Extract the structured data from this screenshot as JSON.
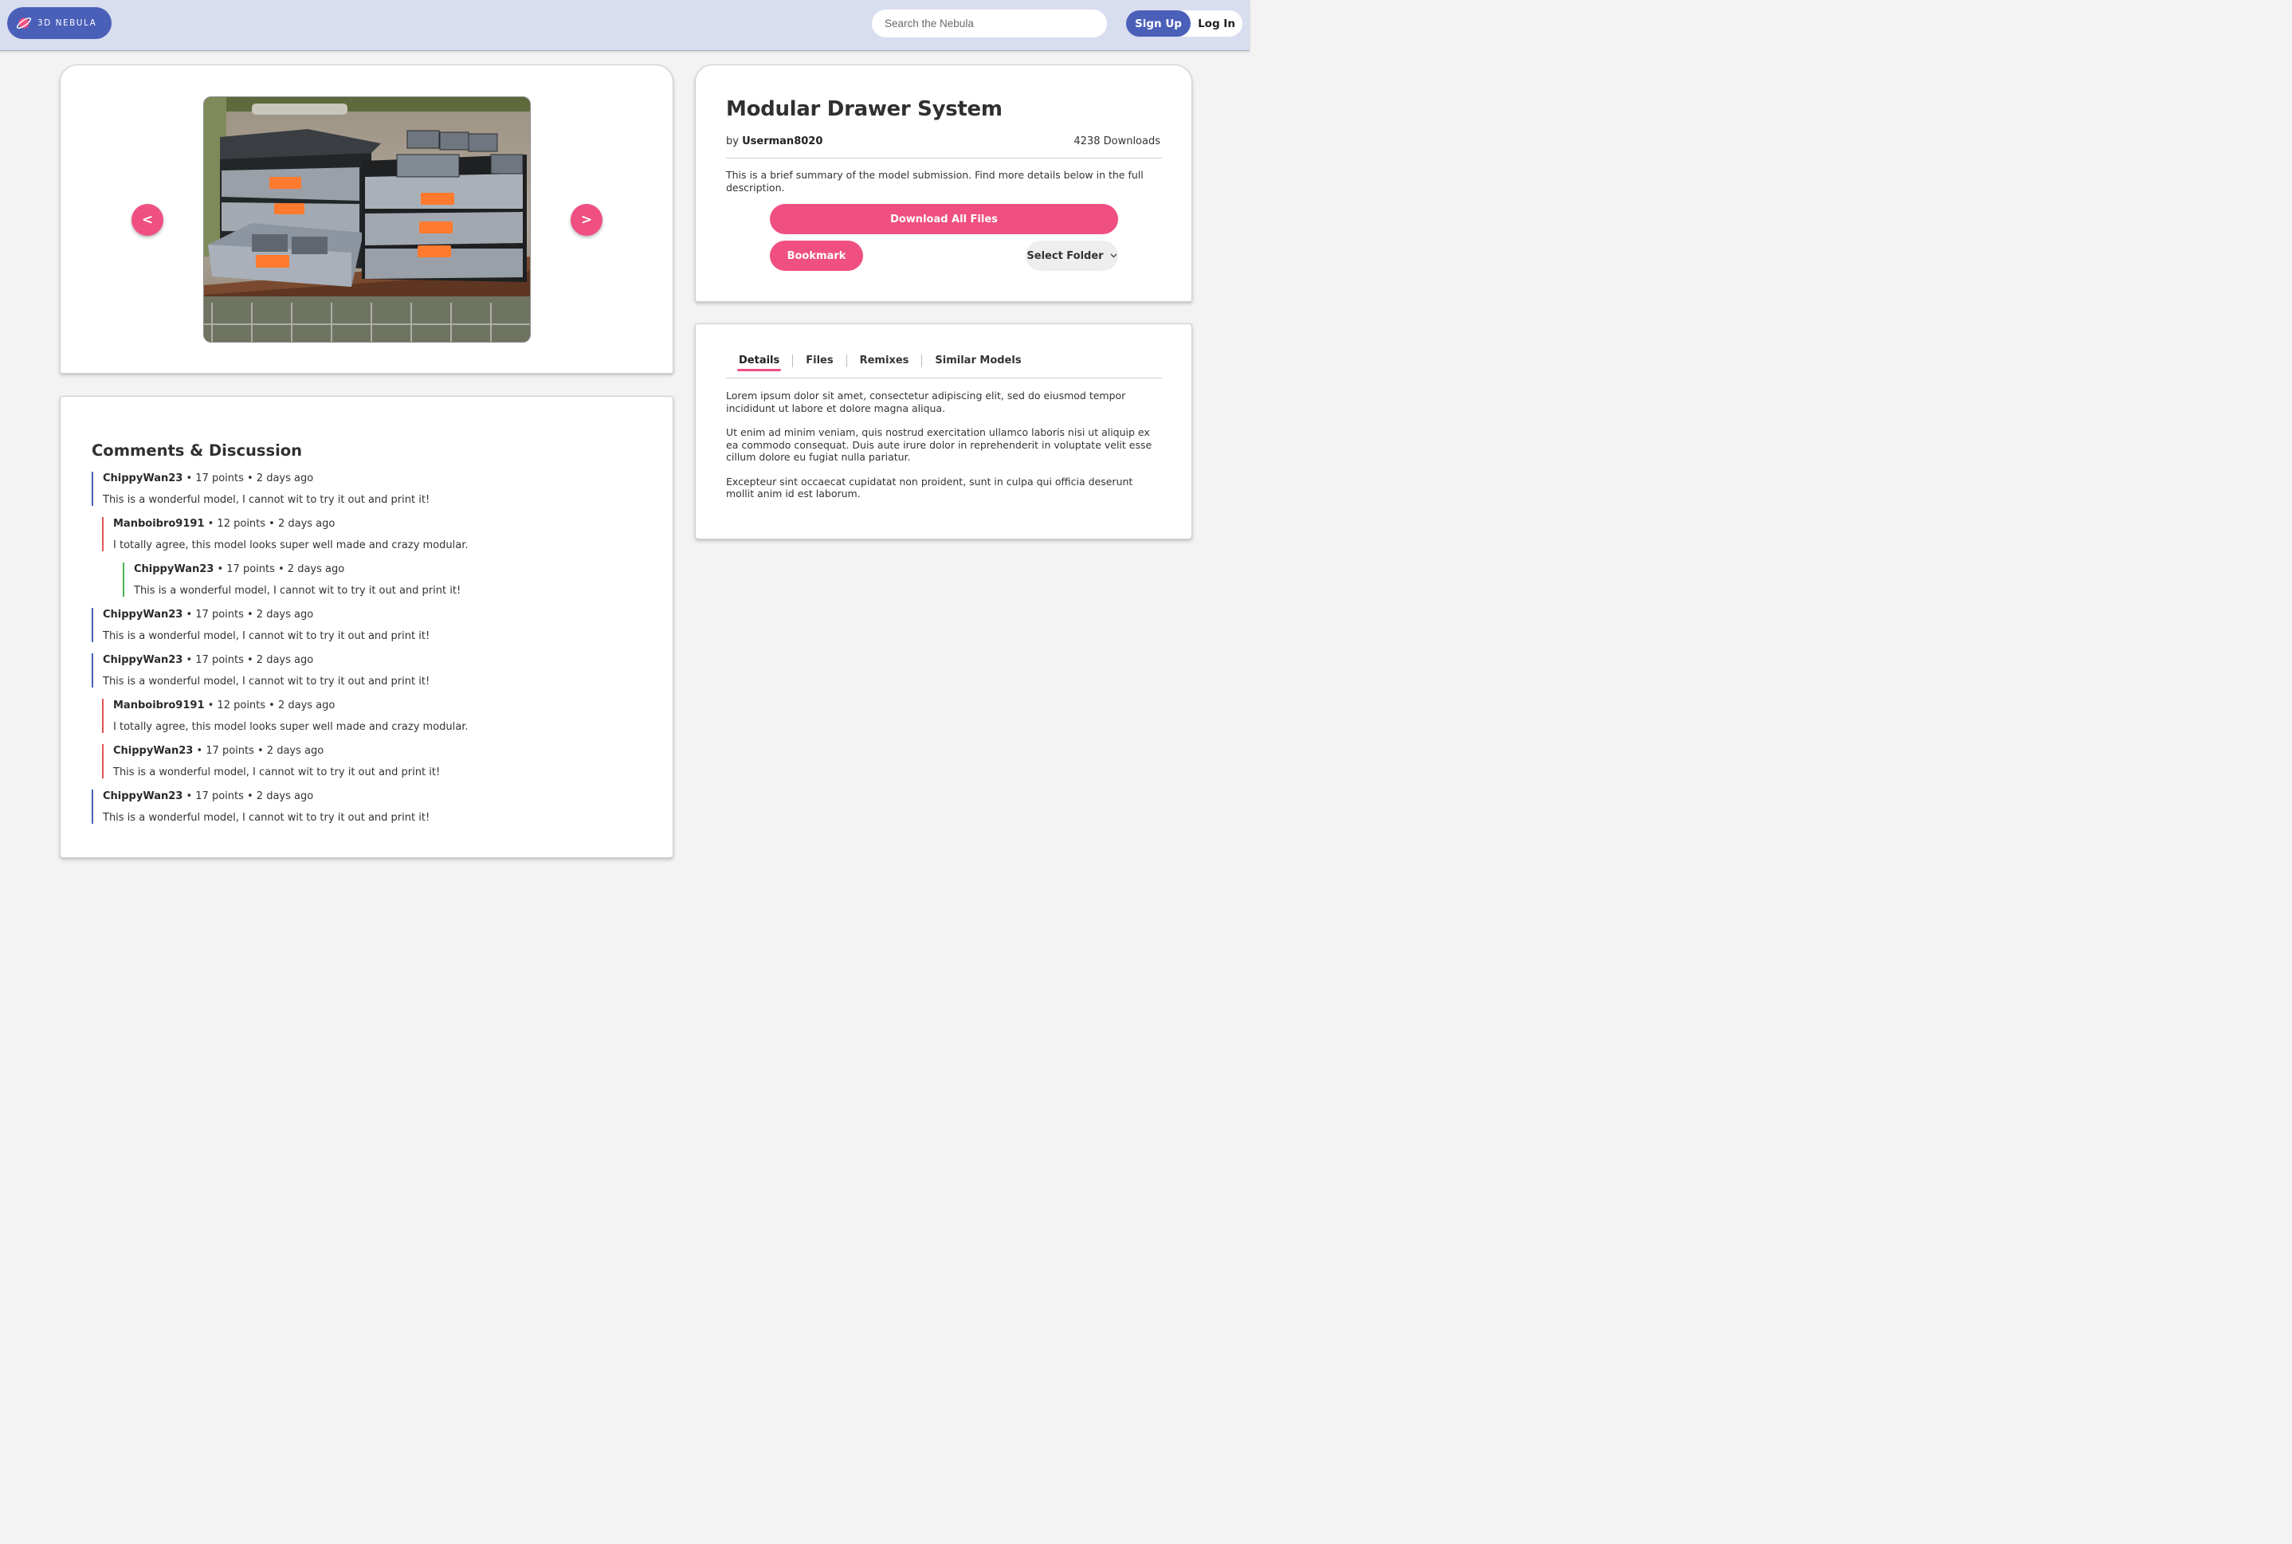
{
  "header": {
    "logo_text": "3D NEBULA",
    "search_placeholder": "Search the Nebula",
    "signup_label": "Sign Up",
    "login_label": "Log In"
  },
  "gallery": {
    "prev_label": "<",
    "next_label": ">"
  },
  "model": {
    "title": "Modular Drawer System",
    "by_prefix": "by",
    "author": "Userman8020",
    "downloads": "4238 Downloads",
    "summary": "This is a brief summary of the model submission. Find more details below in the full description.",
    "download_all_label": "Download All Files",
    "bookmark_label": "Bookmark",
    "folder_label": "Select Folder"
  },
  "details": {
    "tabs": [
      "Details",
      "Files",
      "Remixes",
      "Similar Models"
    ],
    "active_tab": "Details",
    "paragraphs": [
      "Lorem ipsum dolor sit amet, consectetur adipiscing elit, sed do eiusmod tempor incididunt ut labore et dolore magna aliqua.",
      "Ut enim ad minim veniam, quis nostrud exercitation ullamco laboris nisi ut aliquip ex ea commodo consequat. Duis aute irure dolor in reprehenderit in voluptate velit esse cillum dolore eu fugiat nulla pariatur.",
      "Excepteur sint occaecat cupidatat non proident, sunt in culpa qui officia deserunt mollit anim id est laborum."
    ]
  },
  "comments": {
    "title": "Comments & Discussion",
    "items": [
      {
        "depth": 0,
        "user": "ChippyWan23",
        "meta": " • 17 points • 2 days ago",
        "text": "This is a wonderful model, I cannot wit to try it out and print it!",
        "color": "#4a5fb8"
      },
      {
        "depth": 1,
        "user": "Manboibro9191",
        "meta": " • 12 points • 2 days ago",
        "text": "I totally agree, this model looks super well made and crazy modular.",
        "color": "#e05555"
      },
      {
        "depth": 2,
        "user": "ChippyWan23",
        "meta": " • 17 points • 2 days ago",
        "text": "This is a wonderful model, I cannot wit to try it out and print it!",
        "color": "#4caf50"
      },
      {
        "depth": 0,
        "user": "ChippyWan23",
        "meta": " • 17 points • 2 days ago",
        "text": "This is a wonderful model, I cannot wit to try it out and print it!",
        "color": "#4a5fb8"
      },
      {
        "depth": 0,
        "user": "ChippyWan23",
        "meta": " • 17 points • 2 days ago",
        "text": "This is a wonderful model, I cannot wit to try it out and print it!",
        "color": "#4a5fb8"
      },
      {
        "depth": 1,
        "user": "Manboibro9191",
        "meta": " • 12 points • 2 days ago",
        "text": "I totally agree, this model looks super well made and crazy modular.",
        "color": "#e05555"
      },
      {
        "depth": 1,
        "user": "ChippyWan23",
        "meta": " • 17 points • 2 days ago",
        "text": "This is a wonderful model, I cannot wit to try it out and print it!",
        "color": "#e05555"
      },
      {
        "depth": 0,
        "user": "ChippyWan23",
        "meta": " • 17 points • 2 days ago",
        "text": "This is a wonderful model, I cannot wit to try it out and print it!",
        "color": "#4a5fb8"
      }
    ]
  },
  "colors": {
    "brand": "#4a5fb8",
    "accent": "#ef4f81",
    "header_bg": "#d8ddef"
  }
}
